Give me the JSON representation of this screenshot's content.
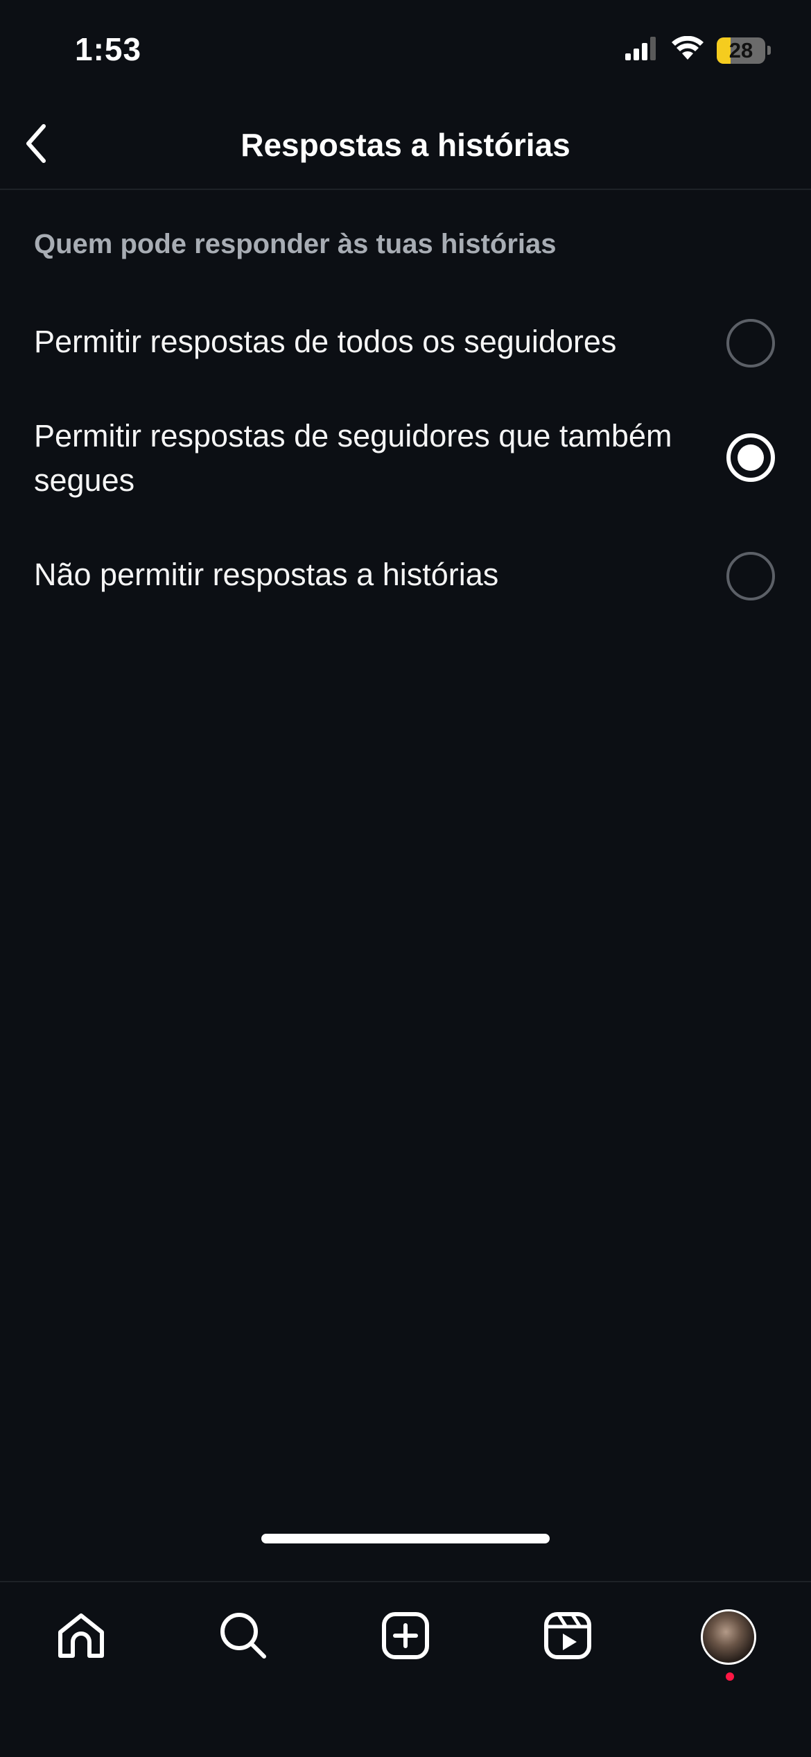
{
  "status_bar": {
    "time": "1:53",
    "battery_level": "28",
    "battery_fraction": 0.28,
    "battery_color": "#f5cc1f",
    "icons": [
      "cellular-signal-icon",
      "wifi-icon",
      "battery-icon"
    ]
  },
  "header": {
    "title": "Respostas a histórias",
    "back_icon": "chevron-left-icon"
  },
  "section": {
    "heading": "Quem pode responder às tuas histórias"
  },
  "options": [
    {
      "label": "Permitir respostas de todos os seguidores",
      "selected": false
    },
    {
      "label": "Permitir respostas de seguidores que também segues",
      "selected": true
    },
    {
      "label": "Não permitir respostas a histórias",
      "selected": false
    }
  ],
  "bottom_nav": {
    "items": [
      "home-icon",
      "search-icon",
      "create-icon",
      "reels-icon",
      "profile-avatar"
    ],
    "notification_color": "#ff1744"
  },
  "colors": {
    "background": "#0c0f14",
    "text_primary": "#ffffff",
    "text_secondary": "#a8adb4",
    "radio_unselected": "#5c6067"
  }
}
